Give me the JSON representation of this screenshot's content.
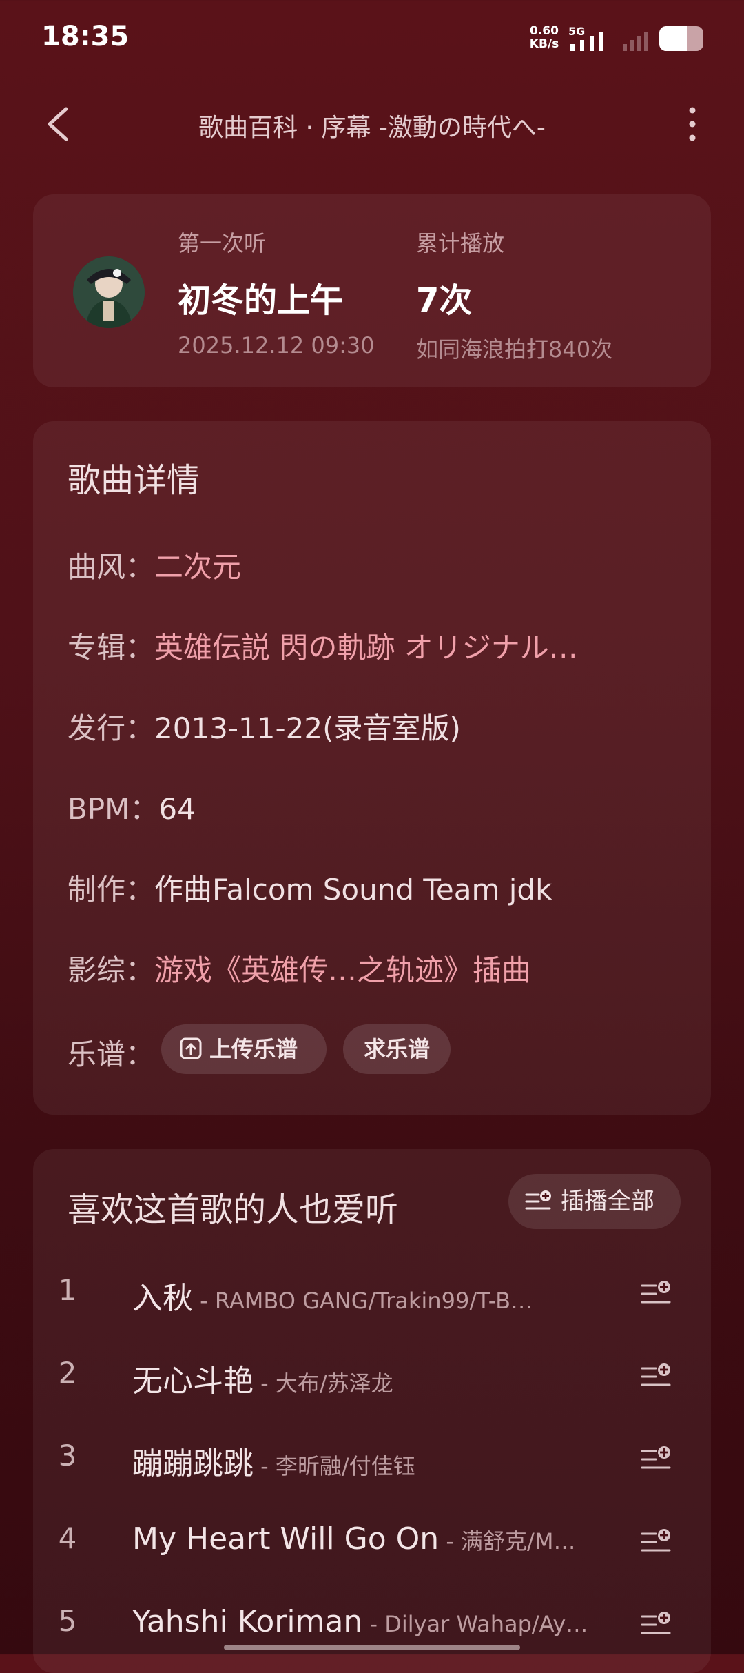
{
  "status_bar": {
    "time": "18:35",
    "net_speed_value": "0.60",
    "net_speed_unit": "KB/s",
    "network_type": "5G",
    "battery_level": 0.62
  },
  "header": {
    "title": "歌曲百科 · 序幕 -激動の時代へ-"
  },
  "listen_stats": {
    "first_listen_label": "第一次听",
    "first_listen_value": "初冬的上午",
    "first_listen_time": "2025.12.12 09:30",
    "total_plays_label": "累计播放",
    "total_plays_value": "7次",
    "total_plays_note": "如同海浪拍打840次"
  },
  "details": {
    "heading": "歌曲详情",
    "genre_label": "曲风：",
    "genre_value": "二次元",
    "album_label": "专辑：",
    "album_value": "英雄伝説 閃の軌跡 オリジナル…",
    "release_label": "发行：",
    "release_value": "2013-11-22(录音室版)",
    "bpm_label": "BPM：",
    "bpm_value": "64",
    "credits_label": "制作：",
    "credits_value": "作曲Falcom Sound Team jdk",
    "media_label": "影综：",
    "media_value": "游戏《英雄传…之轨迹》插曲",
    "sheet_label": "乐谱：",
    "upload_sheet": "上传乐谱",
    "request_sheet": "求乐谱"
  },
  "recommend": {
    "heading": "喜欢这首歌的人也爱听",
    "play_all": "插播全部",
    "songs": [
      {
        "num": "1",
        "title": "入秋",
        "artist": "- RAMBO GANG/Trakin99/T-B…"
      },
      {
        "num": "2",
        "title": "无心斗艳",
        "artist": "- 大布/苏泽龙"
      },
      {
        "num": "3",
        "title": "蹦蹦跳跳",
        "artist": "- 李昕融/付佳钰"
      },
      {
        "num": "4",
        "title": "My Heart Will Go On",
        "artist": "- 满舒克/M…"
      },
      {
        "num": "5",
        "title": "Yahshi Koriman",
        "artist": "- Dilyar Wahap/Ay…"
      }
    ]
  },
  "icons": {
    "back": "chevron-left-icon",
    "more": "more-vertical-icon",
    "upload": "upload-icon",
    "queue_add": "queue-add-icon"
  },
  "colors": {
    "background": "#4f1118",
    "accent_pink": "#f0a0aa"
  }
}
